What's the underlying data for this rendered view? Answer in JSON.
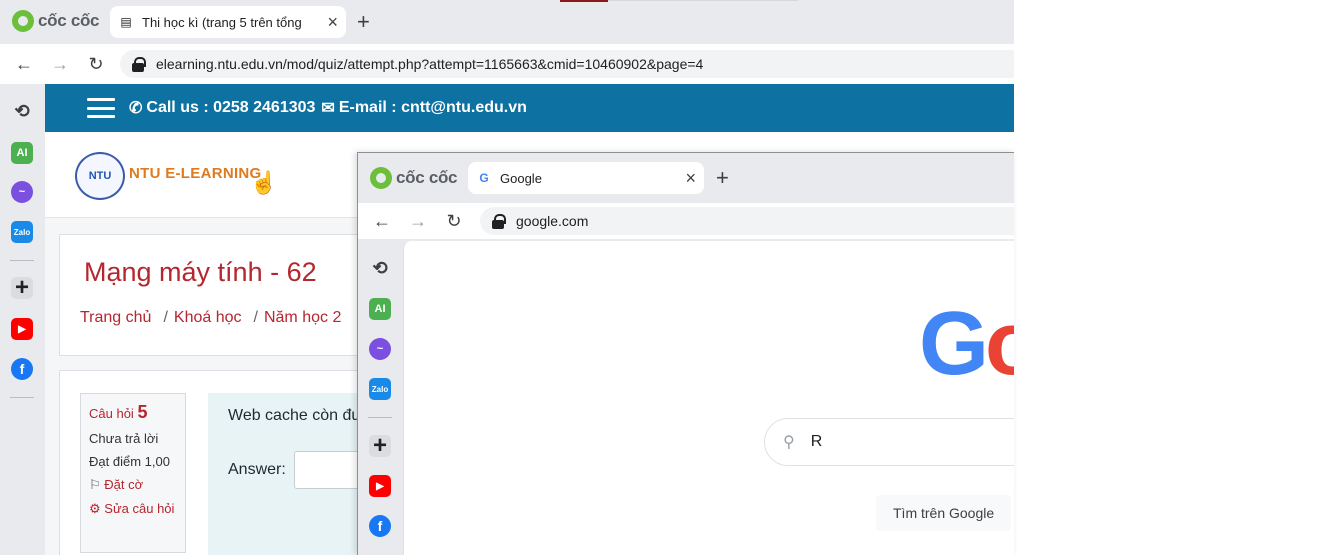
{
  "browser_brand": "cốc cốc",
  "back_window": {
    "tab_title": "Thi học kì (trang 5 trên tổng",
    "tab_close": "×",
    "new_tab": "+",
    "url": "elearning.ntu.edu.vn/mod/quiz/attempt.php?attempt=1165663&cmid=10460902&page=4",
    "sidebar_icons": [
      "history-icon",
      "ai-icon",
      "messenger-icon",
      "zalo-icon",
      "add-icon",
      "youtube-icon",
      "facebook-icon"
    ],
    "site": {
      "call_text": "Call us : 0258 2461303",
      "email_text": "E-mail : cntt@ntu.edu.vn",
      "logo_badge": "NTU",
      "logo_text": "NTU E-LEARNING",
      "course_title": "Mạng máy tính - 62",
      "breadcrumb": {
        "home": "Trang chủ",
        "courses": "Khoá học",
        "year": "Năm học 2",
        "sep": "/"
      },
      "question_info": {
        "label": "Câu hỏi",
        "number": "5",
        "status": "Chưa trả lời",
        "points": "Đạt điểm 1,00",
        "flag": "Đặt cờ",
        "edit": "Sửa câu hỏi"
      },
      "question_text": "Web cache còn đư",
      "answer_label": "Answer:"
    }
  },
  "front_window": {
    "tab_title": "Google",
    "tab_close": "×",
    "new_tab": "+",
    "url": "google.com",
    "logo_partial": {
      "blue": "G",
      "red": "o"
    },
    "search_value": "R",
    "search_button": "Tìm trên Google"
  },
  "colors": {
    "topbar": "#0d71a1",
    "accent_red": "#b5262f",
    "coccoc_green": "#6cbf3a"
  }
}
